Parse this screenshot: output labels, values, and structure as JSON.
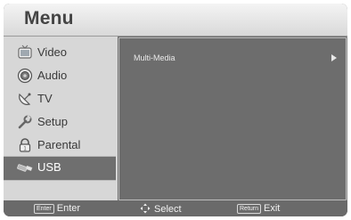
{
  "menu": {
    "title": "Menu",
    "items": [
      {
        "label": "Video",
        "icon": "tv-screen-icon",
        "selected": false
      },
      {
        "label": "Audio",
        "icon": "speaker-icon",
        "selected": false
      },
      {
        "label": "TV",
        "icon": "satellite-dish-icon",
        "selected": false
      },
      {
        "label": "Setup",
        "icon": "wrench-icon",
        "selected": false
      },
      {
        "label": "Parental",
        "icon": "lock-icon",
        "selected": false
      },
      {
        "label": "USB",
        "icon": "usb-drive-icon",
        "selected": true
      }
    ]
  },
  "submenu": {
    "items": [
      {
        "label": "Multi-Media",
        "has_arrow": true
      }
    ]
  },
  "footer": {
    "enter_key": "Enter",
    "enter_label": "Enter",
    "select_label": "Select",
    "return_key": "Return",
    "exit_label": "Exit"
  },
  "colors": {
    "header_bg": "#e6e6e6",
    "sidebar_bg": "#d7d7d7",
    "panel_bg": "#6d6d6d",
    "selected_bg": "#6f6f6f"
  }
}
